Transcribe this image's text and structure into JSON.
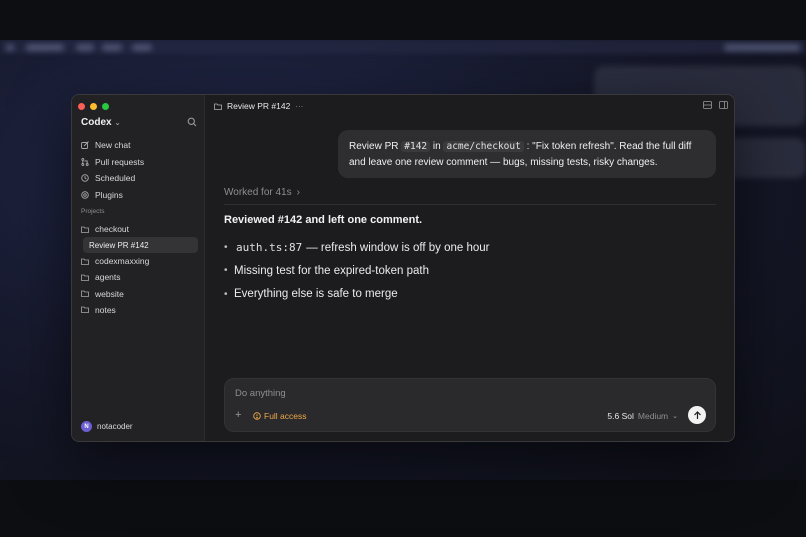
{
  "app": {
    "name": "Codex"
  },
  "nav": [
    {
      "label": "New chat",
      "icon": "new-chat-icon"
    },
    {
      "label": "Pull requests",
      "icon": "pull-request-icon"
    },
    {
      "label": "Scheduled",
      "icon": "clock-icon"
    },
    {
      "label": "Plugins",
      "icon": "plugin-icon"
    }
  ],
  "projects": {
    "label": "Projects",
    "items": [
      {
        "label": "checkout"
      },
      {
        "label": "Review PR #142"
      },
      {
        "label": "codexmaxxing"
      },
      {
        "label": "agents"
      },
      {
        "label": "website"
      },
      {
        "label": "notes"
      }
    ]
  },
  "user": {
    "name": "notacoder",
    "initial": "N"
  },
  "thread": {
    "title": "Review PR #142",
    "more": "···"
  },
  "message": {
    "p1": "Review PR ",
    "pr": "#142",
    "p2": " in ",
    "repo": "acme/checkout",
    "p3": " : \"Fix token refresh\". Read the full diff and leave one review comment — bugs, missing tests, risky changes."
  },
  "worked": {
    "label": "Worked for 41s",
    "chevron": "›"
  },
  "response": {
    "heading": "Reviewed #142 and left one comment.",
    "bullets": [
      {
        "code": "auth.ts:87",
        "text": "— refresh window is off by one hour"
      },
      {
        "code": "",
        "text": "Missing test for the expired-token path"
      },
      {
        "code": "",
        "text": "Everything else is safe to merge"
      }
    ]
  },
  "composer": {
    "placeholder": "Do anything",
    "plus": "+",
    "access_label": "Full access",
    "model": "5.6 Sol",
    "effort": "Medium"
  },
  "colors": {
    "accent": "#f0a84a",
    "avatar": "#6d5fd1"
  }
}
